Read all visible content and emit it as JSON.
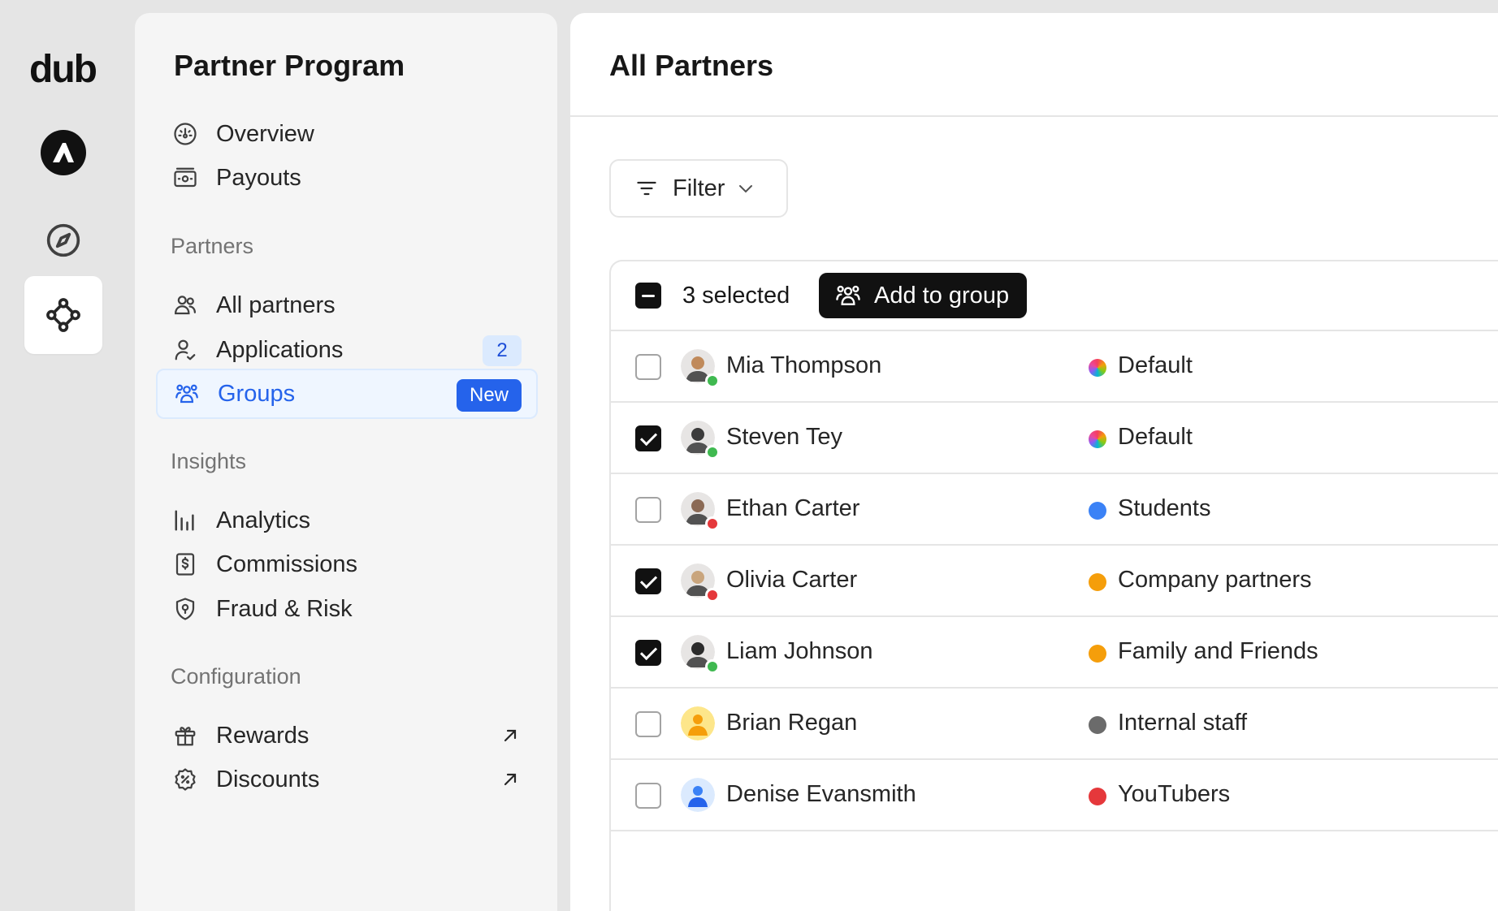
{
  "rail": {
    "logo": "dub",
    "items": [
      {
        "name": "workspace-avatar",
        "icon": "workspace-logo-icon"
      },
      {
        "name": "discover",
        "icon": "compass-icon"
      },
      {
        "name": "partner-program",
        "icon": "network-icon",
        "active": true
      }
    ]
  },
  "sidebar": {
    "title": "Partner Program",
    "top_items": [
      {
        "label": "Overview",
        "icon": "gauge-icon"
      },
      {
        "label": "Payouts",
        "icon": "money-icon"
      }
    ],
    "sections": [
      {
        "title": "Partners",
        "items": [
          {
            "label": "All partners",
            "icon": "users-icon"
          },
          {
            "label": "Applications",
            "icon": "user-check-icon",
            "badge": "2"
          },
          {
            "label": "Groups",
            "icon": "user-group-icon",
            "badge": "New",
            "active": true
          }
        ]
      },
      {
        "title": "Insights",
        "items": [
          {
            "label": "Analytics",
            "icon": "bar-chart-icon"
          },
          {
            "label": "Commissions",
            "icon": "invoice-icon"
          },
          {
            "label": "Fraud & Risk",
            "icon": "shield-icon"
          }
        ]
      },
      {
        "title": "Configuration",
        "items": [
          {
            "label": "Rewards",
            "icon": "gift-icon"
          },
          {
            "label": "Discounts",
            "icon": "discount-icon"
          }
        ]
      }
    ],
    "accent": "#2563eb"
  },
  "main": {
    "title": "All Partners",
    "filter_label": "Filter",
    "selection": {
      "label": "3 selected",
      "action_label": "Add to group"
    },
    "rows": [
      {
        "name": "Mia Thompson",
        "checked": false,
        "status": "#3fb950",
        "group": "Default",
        "group_color": "rainbow",
        "avatar": "#c08a5b"
      },
      {
        "name": "Steven Tey",
        "checked": true,
        "status": "#3fb950",
        "group": "Default",
        "group_color": "rainbow",
        "avatar": "#3b3b3b"
      },
      {
        "name": "Ethan Carter",
        "checked": false,
        "status": "#e5383b",
        "group": "Students",
        "group_color": "#3b82f6",
        "avatar": "#8b6a55"
      },
      {
        "name": "Olivia Carter",
        "checked": true,
        "status": "#e5383b",
        "group": "Company partners",
        "group_color": "#f59e0b",
        "avatar": "#c9a57d"
      },
      {
        "name": "Liam Johnson",
        "checked": true,
        "status": "#3fb950",
        "group": "Family and Friends",
        "group_color": "#f59e0b",
        "avatar": "#2b2b2b"
      },
      {
        "name": "Brian Regan",
        "checked": false,
        "status": "",
        "group": "Internal staff",
        "group_color": "#6b6b6b",
        "avatar": "placeholder-orange"
      },
      {
        "name": "Denise Evansmith",
        "checked": false,
        "status": "",
        "group": "YouTubers",
        "group_color": "#e5383b",
        "avatar": "placeholder-blue"
      }
    ]
  }
}
